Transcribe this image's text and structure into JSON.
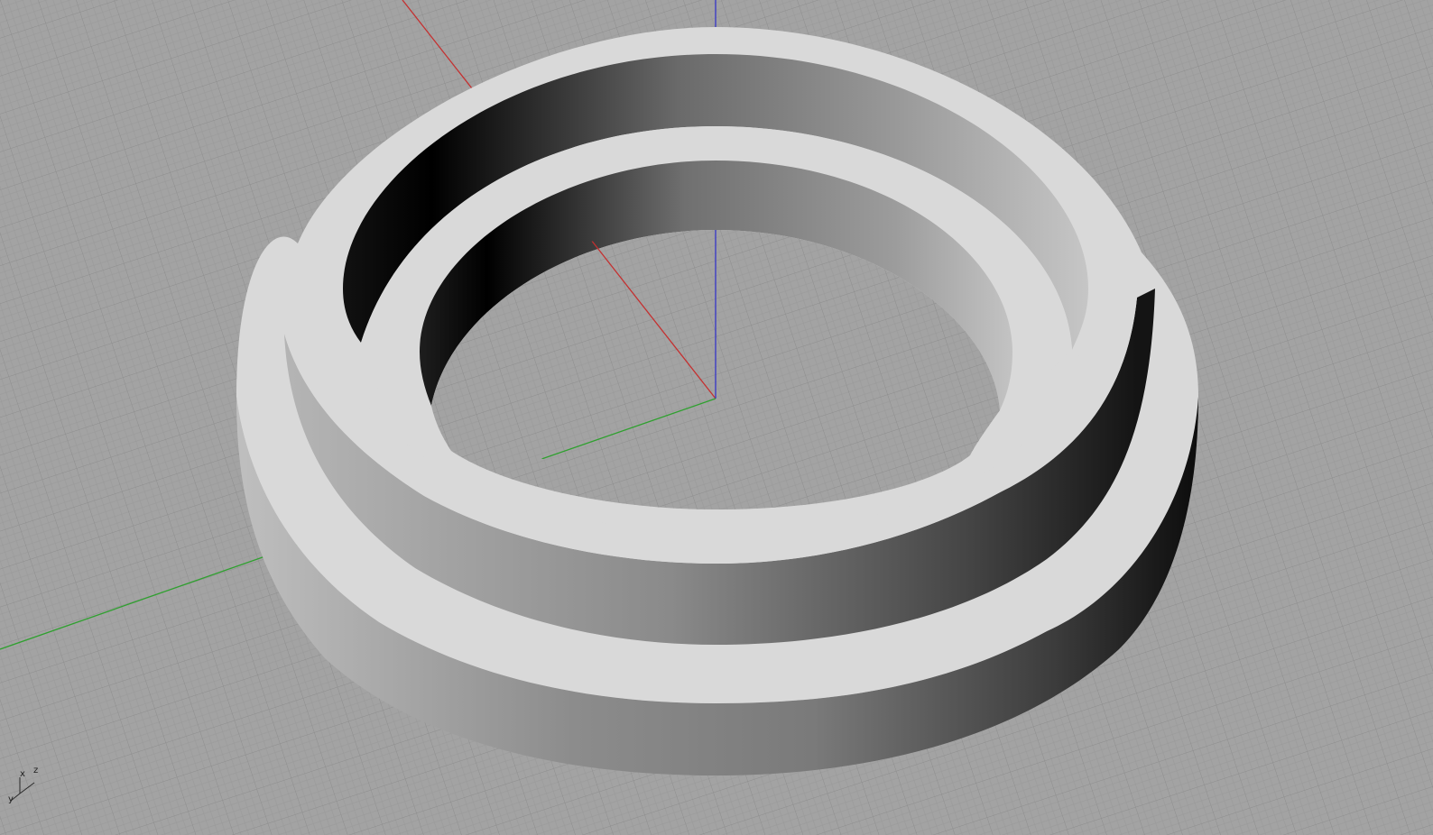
{
  "viewport": {
    "background": "#a3a3a3",
    "grid_minor_color": "#9a9a9a",
    "grid_major_color": "#8a8a8a",
    "axis_colors": {
      "x": "#c43030",
      "y": "#2fa02f",
      "z": "#3030c4"
    },
    "model": "twisted-ring",
    "shading": "shaded"
  },
  "gizmo": {
    "x": "x",
    "y": "y",
    "z": "z"
  }
}
